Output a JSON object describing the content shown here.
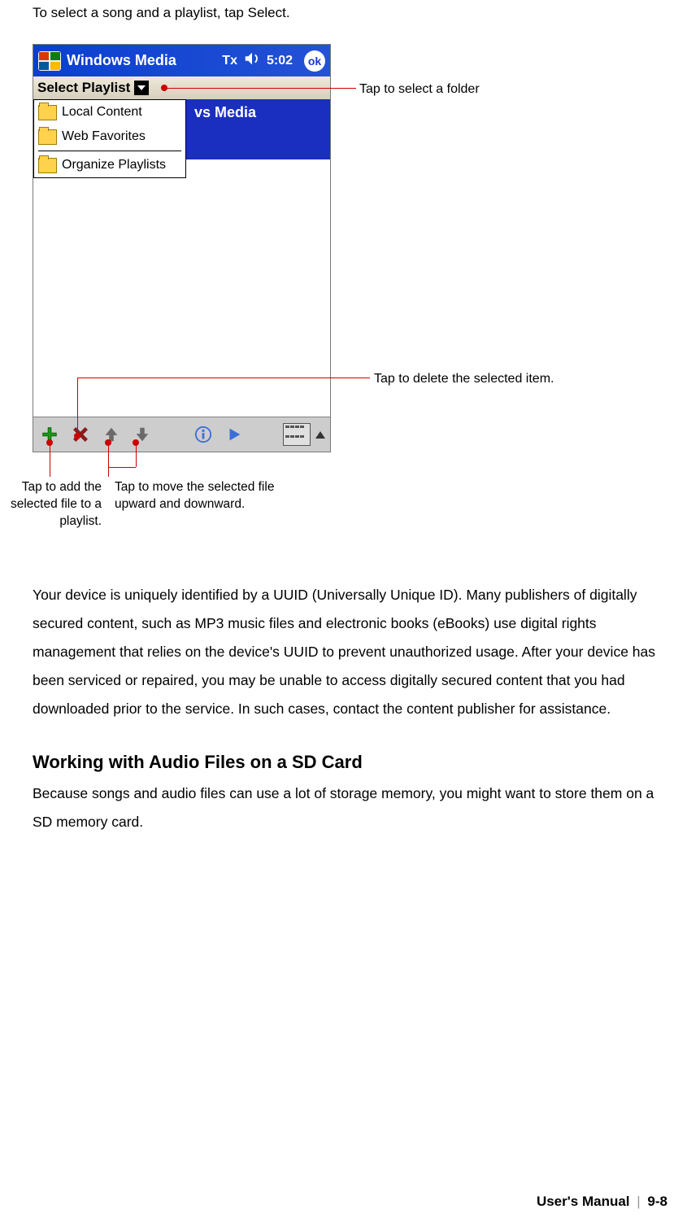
{
  "intro": "To select a song and a playlist, tap Select.",
  "device": {
    "titlebar": {
      "title": "Windows Media",
      "signal": "Tx",
      "time": "5:02",
      "ok": "ok"
    },
    "playlist_label": "Select Playlist",
    "dropdown": {
      "item1": "Local Content",
      "item2": "Web Favorites",
      "item3": "Organize Playlists"
    },
    "app_banner": "vs Media"
  },
  "callouts": {
    "folder": "Tap to select a folder",
    "delete": "Tap to delete the selected item.",
    "add": "Tap to add the selected file to a playlist.",
    "move": "Tap to move the selected file upward and downward."
  },
  "body_para": "Your device is uniquely identified by a UUID (Universally Unique ID). Many publishers of digitally secured content, such as MP3 music files and electronic books (eBooks) use digital rights management that relies on the device's UUID to prevent unauthorized usage. After your device has been serviced or repaired, you may be unable to access digitally secured content that you had downloaded prior to the service. In such cases, contact the content publisher for assistance.",
  "section_heading": "Working with Audio Files on a SD Card",
  "section_para": "Because songs and audio files can use a lot of storage memory, you might want to store them on a SD memory card.",
  "footer": {
    "label": "User's Manual",
    "sep": "|",
    "page": "9-8"
  }
}
